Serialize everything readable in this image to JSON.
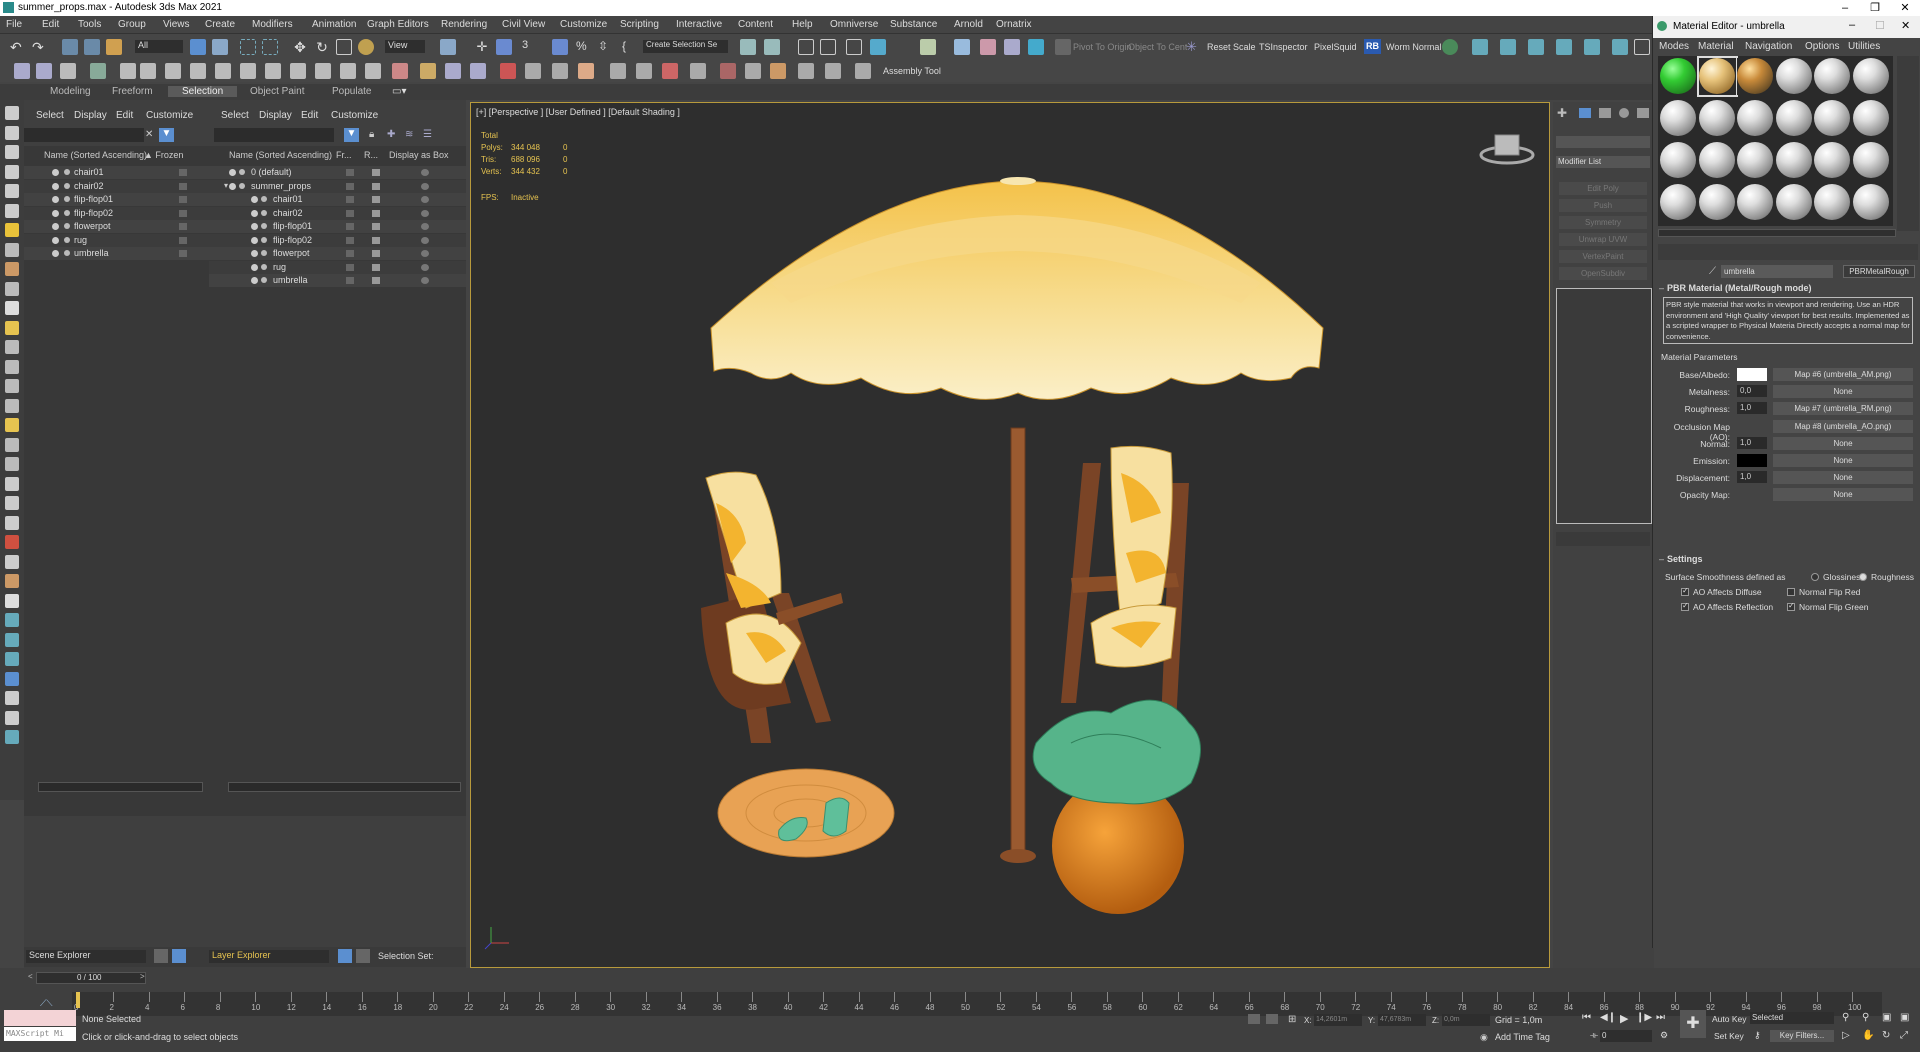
{
  "window": {
    "title": "summer_props.max - Autodesk 3ds Max 2021"
  },
  "menu": [
    "File",
    "Edit",
    "Tools",
    "Group",
    "Views",
    "Create",
    "Modifiers",
    "Animation",
    "Graph Editors",
    "Rendering",
    "Civil View",
    "Customize",
    "Scripting",
    "Interactive",
    "Content",
    "Help",
    "Omniverse",
    "Substance",
    "Arnold",
    "Ornatrix"
  ],
  "toolbar": {
    "selection_filter": "All",
    "coord_system": "View",
    "named_selection": "Create Selection Se",
    "pivot_to_origin": "Pivot To Origin",
    "object_to_center": "Object To Cent",
    "reset_scale": "Reset Scale",
    "tsinspector": "TSInspector",
    "pixelsquid": "PixelSquid",
    "rb": "RB",
    "worm_normal": "Worm Normal",
    "assembly_tool": "Assembly Tool"
  },
  "ribbon_tabs": [
    "Modeling",
    "Freeform",
    "Selection",
    "Object Paint",
    "Populate"
  ],
  "scene_explorer": {
    "menu": [
      "Select",
      "Display",
      "Edit",
      "Customize"
    ],
    "col_name": "Name (Sorted Ascending)",
    "col_frozen": "▲ Frozen",
    "items": [
      "chair01",
      "chair02",
      "flip-flop01",
      "flip-flop02",
      "flowerpot",
      "rug",
      "umbrella"
    ],
    "footer_label": "Scene Explorer"
  },
  "layer_explorer": {
    "menu": [
      "Select",
      "Display",
      "Edit",
      "Customize"
    ],
    "col_name": "Name (Sorted Ascending)",
    "col_fr": "Fr...",
    "col_r": "R...",
    "col_display": "Display as Box",
    "layers": [
      "0 (default)",
      "summer_props"
    ],
    "children": [
      "chair01",
      "chair02",
      "flip-flop01",
      "flip-flop02",
      "flowerpot",
      "rug",
      "umbrella"
    ],
    "footer_label": "Layer Explorer",
    "selection_sets": "Selection Set:"
  },
  "viewport": {
    "label": "[+] [Perspective ] [User Defined ] [Default Shading ]",
    "stats_header": "Total",
    "polys_label": "Polys:",
    "polys_total": "344 048",
    "polys_sel": "0",
    "tris_label": "Tris:",
    "tris_total": "688 096",
    "tris_sel": "0",
    "verts_label": "Verts:",
    "verts_total": "344 432",
    "verts_sel": "0",
    "fps_label": "FPS:",
    "fps_value": "Inactive"
  },
  "command_panel": {
    "modifier_list": "Modifier List",
    "buttons": [
      "Edit Poly",
      "Push",
      "Symmetry",
      "Unwrap UVW",
      "VertexPaint",
      "OpenSubdiv"
    ]
  },
  "material_editor": {
    "title": "Material Editor - umbrella",
    "menu": [
      "Modes",
      "Material",
      "Navigation",
      "Options",
      "Utilities"
    ],
    "material_name": "umbrella",
    "material_type": "PBRMetalRough",
    "rollout_title": "PBR Material (Metal/Rough mode)",
    "description": "PBR style material that works in viewport and rendering. Use an HDR environment and 'High Quality' viewport for best results. Implemented as a scripted wrapper to Physical Materia Directly accepts a normal map for convenience.",
    "params_title": "Material Parameters",
    "params": [
      {
        "label": "Base/Albedo:",
        "kind": "swatch",
        "color": "#ffffff",
        "map": "Map #6 (umbrella_AM.png)"
      },
      {
        "label": "Metalness:",
        "kind": "spin",
        "value": "0,0",
        "map": "None"
      },
      {
        "label": "Roughness:",
        "kind": "spin",
        "value": "1,0",
        "map": "Map #7 (umbrella_RM.png)"
      },
      {
        "label": "Occlusion Map (AO):",
        "kind": "none",
        "map": "Map #8 (umbrella_AO.png)"
      },
      {
        "label": "Normal:",
        "kind": "spin",
        "value": "1,0",
        "map": "None"
      },
      {
        "label": "Emission:",
        "kind": "swatch",
        "color": "#000000",
        "map": "None"
      },
      {
        "label": "Displacement:",
        "kind": "spin",
        "value": "1,0",
        "map": "None"
      },
      {
        "label": "Opacity Map:",
        "kind": "none",
        "map": "None"
      }
    ],
    "settings_title": "Settings",
    "smoothness_label": "Surface Smoothness defined as",
    "glossiness": "Glossiness",
    "roughness": "Roughness",
    "ao_diffuse": "AO Affects Diffuse",
    "ao_reflection": "AO Affects Reflection",
    "flip_red": "Normal Flip Red",
    "flip_green": "Normal Flip Green"
  },
  "timeline": {
    "frame_display": "0 / 100",
    "ticks": [
      "0",
      "2",
      "4",
      "6",
      "8",
      "10",
      "12",
      "14",
      "16",
      "18",
      "20",
      "22",
      "24",
      "26",
      "28",
      "30",
      "32",
      "34",
      "36",
      "38",
      "40",
      "42",
      "44",
      "46",
      "48",
      "50",
      "52",
      "54",
      "56",
      "58",
      "60",
      "62",
      "64",
      "66",
      "68",
      "70",
      "72",
      "74",
      "76",
      "78",
      "80",
      "82",
      "84",
      "86",
      "88",
      "90",
      "92",
      "94",
      "96",
      "98",
      "100"
    ]
  },
  "status": {
    "maxscript": "MAXScript Mi",
    "selection": "None Selected",
    "prompt": "Click or click-and-drag to select objects",
    "x_label": "X:",
    "x_value": "14,2601m",
    "y_label": "Y:",
    "y_value": "47,6783m",
    "z_label": "Z:",
    "z_value": "0,0m",
    "grid": "Grid = 1,0m",
    "add_time_tag": "Add Time Tag",
    "auto_key": "Auto Key",
    "selected": "Selected",
    "set_key": "Set Key",
    "key_filters": "Key Filters...",
    "frame": "0"
  }
}
